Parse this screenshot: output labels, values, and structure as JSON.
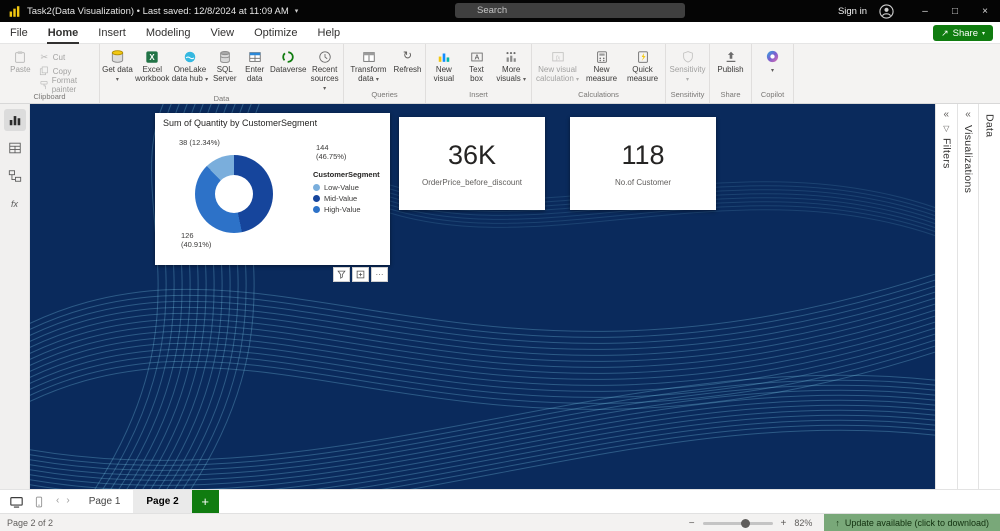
{
  "titlebar": {
    "title": "Task2(Data Visualization) • Last saved: 12/8/2024 at 11:09 AM",
    "search_placeholder": "Search",
    "sign_in_label": "Sign in"
  },
  "menubar": {
    "items": [
      "File",
      "Home",
      "Insert",
      "Modeling",
      "View",
      "Optimize",
      "Help"
    ],
    "active_item": "Home",
    "share_label": "Share"
  },
  "ribbon": {
    "groups": [
      {
        "label": "Clipboard",
        "buttons": [
          {
            "label": "Paste"
          },
          {
            "label": "Cut"
          },
          {
            "label": "Copy"
          },
          {
            "label": "Format painter"
          }
        ]
      },
      {
        "label": "Data",
        "buttons": [
          {
            "label": "Get data"
          },
          {
            "label": "Excel workbook"
          },
          {
            "label": "OneLake data hub"
          },
          {
            "label": "SQL Server"
          },
          {
            "label": "Enter data"
          },
          {
            "label": "Dataverse"
          },
          {
            "label": "Recent sources"
          }
        ]
      },
      {
        "label": "Queries",
        "buttons": [
          {
            "label": "Transform data"
          },
          {
            "label": "Refresh"
          }
        ]
      },
      {
        "label": "Insert",
        "buttons": [
          {
            "label": "New visual"
          },
          {
            "label": "Text box"
          },
          {
            "label": "More visuals"
          }
        ]
      },
      {
        "label": "Calculations",
        "buttons": [
          {
            "label": "New visual calculation"
          },
          {
            "label": "New measure"
          },
          {
            "label": "Quick measure"
          }
        ]
      },
      {
        "label": "Sensitivity",
        "buttons": [
          {
            "label": "Sensitivity"
          }
        ]
      },
      {
        "label": "Share",
        "buttons": [
          {
            "label": "Publish"
          }
        ]
      },
      {
        "label": "Copilot",
        "buttons": []
      }
    ]
  },
  "panels": {
    "filters_label": "Filters",
    "visualizations_label": "Visualizations",
    "data_label": "Data"
  },
  "tabbar": {
    "pages": [
      "Page 1",
      "Page 2"
    ],
    "active_page": "Page 2",
    "add_label": "+"
  },
  "statusbar": {
    "page_indicator": "Page 2 of 2",
    "zoom_level": "82%",
    "update_notice": "Update available (click to download)"
  },
  "chart_data": [
    {
      "type": "pie",
      "donut": true,
      "title": "Sum of Quantity by CustomerSegment",
      "legend_title": "CustomerSegment",
      "legend_position": "right",
      "categories": [
        "Low-Value",
        "Mid-Value",
        "High-Value"
      ],
      "values": [
        38,
        144,
        126
      ],
      "percentages": [
        "12.34%",
        "46.75%",
        "40.91%"
      ],
      "data_labels": [
        "38 (12.34%)",
        "144 (46.75%)",
        "126 (40.91%)"
      ],
      "colors": [
        "#7aaedc",
        "#16459c",
        "#2d72c8"
      ],
      "slice_order": [
        1,
        2,
        0
      ]
    },
    {
      "type": "card",
      "value": "36K",
      "title": "OrderPrice_before_discount"
    },
    {
      "type": "card",
      "value": "118",
      "title": "No.of Customer"
    }
  ]
}
